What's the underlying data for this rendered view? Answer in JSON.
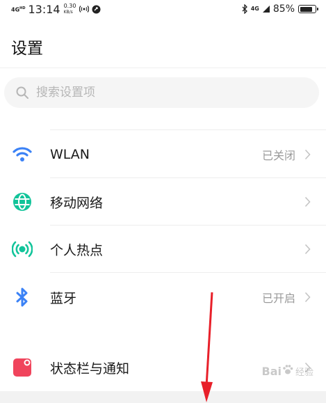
{
  "status_bar": {
    "network": "4G",
    "network_sup": "HD",
    "time": "13:14",
    "speed_value": "0.30",
    "speed_unit": "KB/s",
    "network_right": "4G",
    "battery_percent": "85%",
    "battery_level": 0.85
  },
  "header": {
    "title": "设置"
  },
  "search": {
    "placeholder": "搜索设置项"
  },
  "settings": [
    {
      "label": "WLAN",
      "value": "已关闭",
      "icon": "wifi-icon",
      "color": "#3b82f6"
    },
    {
      "label": "移动网络",
      "value": "",
      "icon": "globe-icon",
      "color": "#12c49a"
    },
    {
      "label": "个人热点",
      "value": "",
      "icon": "hotspot-icon",
      "color": "#12c49a"
    },
    {
      "label": "蓝牙",
      "value": "已开启",
      "icon": "bluetooth-icon",
      "color": "#3b82f6"
    },
    {
      "label": "状态栏与通知",
      "value": "",
      "icon": "notification-icon",
      "color": "#f0445c"
    }
  ],
  "watermark": {
    "text": "Bai",
    "sub": "经验"
  },
  "annotation_color": "#e8202a"
}
